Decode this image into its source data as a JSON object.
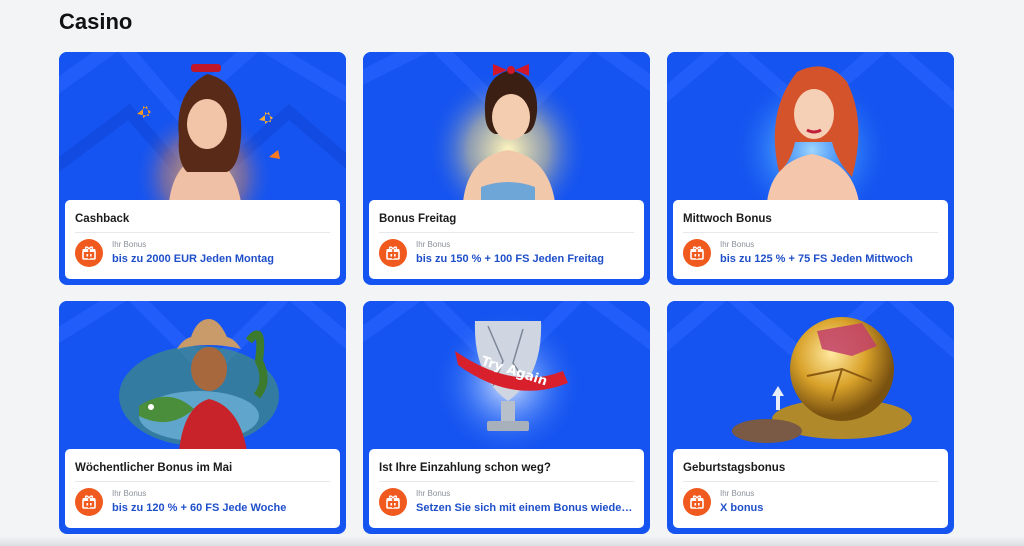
{
  "section": {
    "title": "Casino"
  },
  "cards": [
    {
      "title": "Cashback",
      "bonus_label": "Ihr Bonus",
      "bonus_value": "bis zu 2000 EUR Jeden Montag",
      "art": "woman-butterflies"
    },
    {
      "title": "Bonus Freitag",
      "bonus_label": "Ihr Bonus",
      "bonus_value": "bis zu 150 % + 100 FS Jeden Freitag",
      "art": "woman-red-bow"
    },
    {
      "title": "Mittwoch Bonus",
      "bonus_label": "Ihr Bonus",
      "bonus_value": "bis zu 125 % + 75 FS Jeden Mittwoch",
      "art": "redhead-woman"
    },
    {
      "title": "Wöchentlicher Bonus im Mai",
      "bonus_label": "Ihr Bonus",
      "bonus_value": "bis zu 120 % + 60 FS Jede Woche",
      "art": "cowgirl-with-fish"
    },
    {
      "title": "Ist Ihre Einzahlung schon weg?",
      "bonus_label": "Ihr Bonus",
      "bonus_value": "Setzen Sie sich mit einem Bonus wieder ins Spiel",
      "art": "trophy",
      "art_text": "Try Again"
    },
    {
      "title": "Geburtstagsbonus",
      "bonus_label": "Ihr Bonus",
      "bonus_value": "X bonus",
      "art": "golden-ball"
    }
  ],
  "colors": {
    "card_background": "#1554f0",
    "accent_orange": "#f05a1e",
    "bonus_text": "#1f4fc9"
  },
  "icons": {
    "bonus": "gift-icon"
  }
}
